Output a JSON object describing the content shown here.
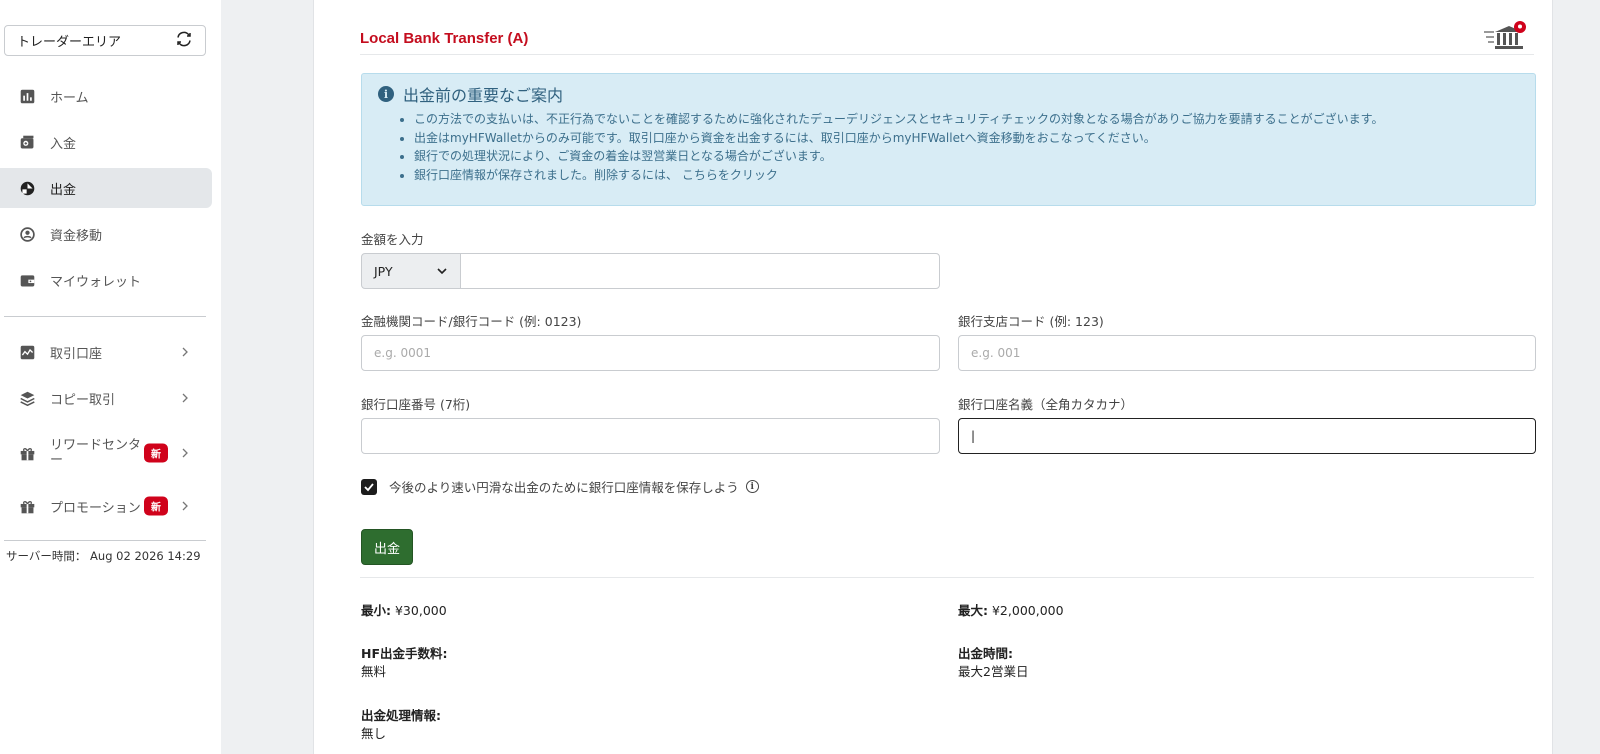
{
  "sidebar": {
    "area_label": "トレーダーエリア",
    "items": [
      {
        "label": "ホーム"
      },
      {
        "label": "入金"
      },
      {
        "label": "出金"
      },
      {
        "label": "資金移動"
      },
      {
        "label": "マイウォレット"
      },
      {
        "label": "取引口座"
      },
      {
        "label": "コピー取引"
      },
      {
        "label": "リワードセンター",
        "badge": "新"
      },
      {
        "label": "プロモーション",
        "badge": "新"
      }
    ],
    "server_time_label": "サーバー時間：",
    "server_time_value": "Aug 02 2026 14:29"
  },
  "card": {
    "title": "Local Bank Transfer (A)",
    "notice": {
      "heading": "出金前の重要なご案内",
      "items": [
        "この方法での支払いは、不正行為でないことを確認するために強化されたデューデリジェンスとセキュリティチェックの対象となる場合がありご協力を要請することがございます。",
        "出金はmyHFWalletからのみ可能です。取引口座から資金を出金するには、取引口座からmyHFWalletへ資金移動をおこなってください。",
        "銀行での処理状況により、ご資金の着金は翌営業日となる場合がございます。",
        "銀行口座情報が保存されました。削除するには、 こちらをクリック"
      ]
    },
    "amount": {
      "label": "金額を入力",
      "currency": "JPY",
      "value": ""
    },
    "bank_code": {
      "label": "金融機関コード/銀行コード (例: 0123)",
      "placeholder": "e.g. 0001"
    },
    "branch_code": {
      "label": "銀行支店コード (例: 123)",
      "placeholder": "e.g. 001"
    },
    "account_number": {
      "label": "銀行口座番号 (7桁)",
      "value": ""
    },
    "account_name": {
      "label": "銀行口座名義（全角カタカナ）",
      "value": "|"
    },
    "save_info_label": "今後のより速い円滑な出金のために銀行口座情報を保存しよう",
    "submit_label": "出金",
    "limits": {
      "min_label": "最小:",
      "min_value": "¥30,000",
      "max_label": "最大:",
      "max_value": "¥2,000,000",
      "fee_label": "HF出金手数料:",
      "fee_value": "無料",
      "time_label": "出金時間:",
      "time_value": "最大2営業日",
      "processing_label": "出金処理情報:",
      "processing_value": "無し"
    }
  },
  "colors": {
    "title_red": "#c40d1e",
    "submit_green": "#2e6d2f",
    "notice_bg": "#d8ecf5",
    "badge_red": "#d0021b"
  }
}
